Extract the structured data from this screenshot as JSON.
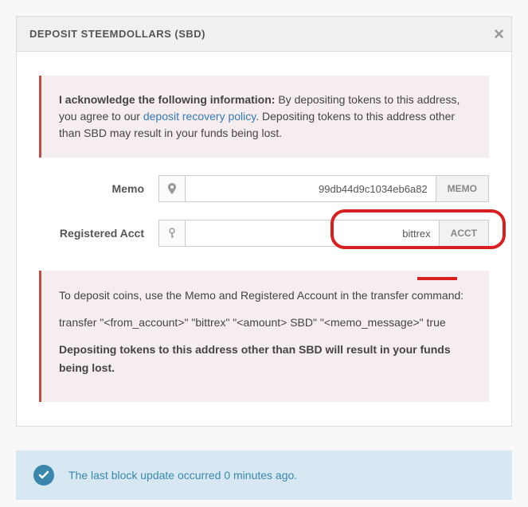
{
  "modal": {
    "title": "DEPOSIT STEEMDOLLARS (SBD)",
    "acknowledge_label": "I acknowledge the following information:",
    "acknowledge_text_1": " By depositing tokens to this address, you agree to our ",
    "acknowledge_link": "deposit recovery policy",
    "acknowledge_text_2": ". Depositing tokens to this address other than SBD may result in your funds being lost.",
    "memo": {
      "label": "Memo",
      "value": "99db44d9c1034eb6a82",
      "suffix": "MEMO"
    },
    "acct": {
      "label": "Registered Acct",
      "value": "bittrex",
      "suffix": "ACCT"
    },
    "instructions": {
      "line1": "To deposit coins, use the Memo and Registered Account in the transfer command:",
      "line2": "transfer \"<from_account>\" \"bittrex\" \"<amount> SBD\" \"<memo_message>\" true",
      "line3": "Depositing tokens to this address other than SBD will result in your funds being lost."
    }
  },
  "footer": {
    "text": "The last block update occurred 0 minutes ago."
  }
}
